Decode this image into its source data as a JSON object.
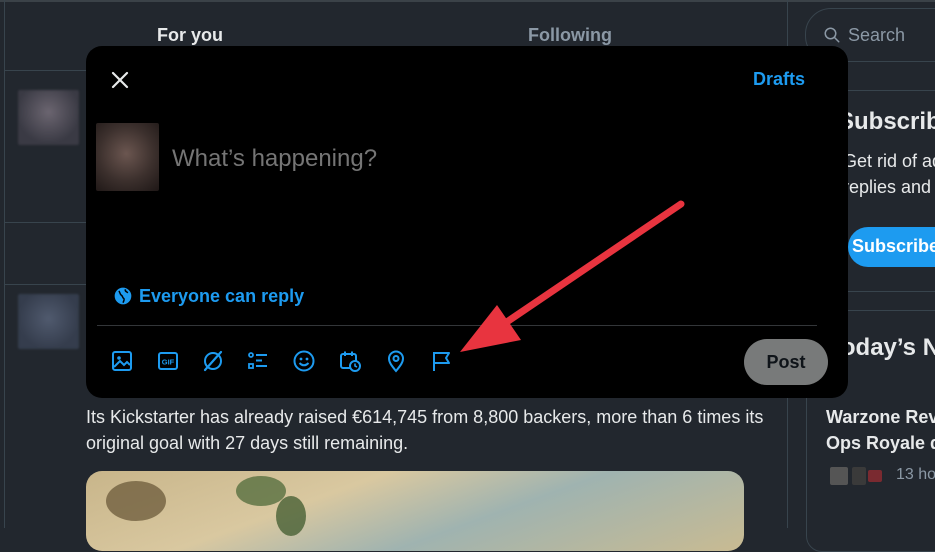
{
  "timeline": {
    "tabs": [
      {
        "label": "For you"
      },
      {
        "label": "Following"
      }
    ],
    "tweet_text": "Its Kickstarter has already raised €614,745 from 8,800 backers, more than 6 times its original goal with 27 days still remaining."
  },
  "sidebar": {
    "search_placeholder": "Search",
    "subscribe": {
      "title": "Subscribe",
      "line1": "Get rid of ad",
      "line2": "replies and u",
      "button": "Subscribe"
    },
    "news": {
      "title": "Today’s N",
      "trend_line1": "Warzone Rev",
      "trend_line2": "Ops Royale d",
      "time": "13 ho"
    }
  },
  "compose": {
    "drafts_label": "Drafts",
    "placeholder": "What’s happening?",
    "reply_setting": "Everyone can reply",
    "post_label": "Post",
    "toolbar_icons": [
      "media-icon",
      "gif-icon",
      "grok-icon",
      "poll-icon",
      "emoji-icon",
      "schedule-icon",
      "location-icon",
      "flag-icon"
    ]
  },
  "colors": {
    "accent": "#1d9bf0",
    "modal_bg": "#000000",
    "page_bg": "#22272e",
    "post_button_disabled": "#787a7a",
    "annotation_arrow": "#e8343f"
  }
}
